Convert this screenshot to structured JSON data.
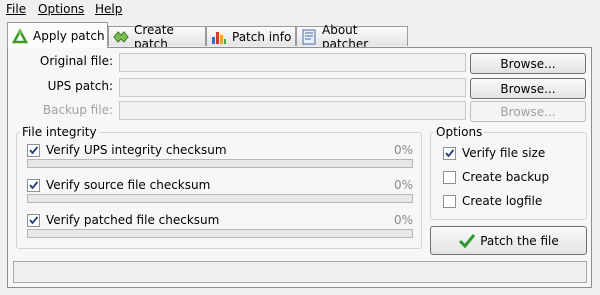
{
  "menu": {
    "items": [
      {
        "label": "File"
      },
      {
        "label": "Options"
      },
      {
        "label": "Help"
      }
    ]
  },
  "tabs": [
    {
      "label": "Apply patch",
      "icon": "apply-patch-icon"
    },
    {
      "label": "Create patch",
      "icon": "create-patch-icon"
    },
    {
      "label": "Patch info",
      "icon": "chart-icon"
    },
    {
      "label": "About patcher",
      "icon": "document-icon"
    }
  ],
  "files": {
    "original_label": "Original file:",
    "original_value": "",
    "ups_label": "UPS patch:",
    "ups_value": "",
    "backup_label": "Backup file:",
    "backup_value": "",
    "browse_label": "Browse..."
  },
  "integrity": {
    "title": "File integrity",
    "items": [
      {
        "label": "Verify UPS integrity checksum",
        "checked": true,
        "percent_text": "0%",
        "progress": 0
      },
      {
        "label": "Verify source file checksum",
        "checked": true,
        "percent_text": "0%",
        "progress": 0
      },
      {
        "label": "Verify patched file checksum",
        "checked": true,
        "percent_text": "0%",
        "progress": 0
      }
    ]
  },
  "options": {
    "title": "Options",
    "items": [
      {
        "label": "Verify file size",
        "checked": true
      },
      {
        "label": "Create backup",
        "checked": false
      },
      {
        "label": "Create logfile",
        "checked": false
      }
    ]
  },
  "patch_button": {
    "label": "Patch the file",
    "icon": "checkmark-icon"
  },
  "status": {
    "text": ""
  },
  "colors": {
    "accent_check": "#2c9b2c",
    "progress_fill": "#3ab03a"
  }
}
